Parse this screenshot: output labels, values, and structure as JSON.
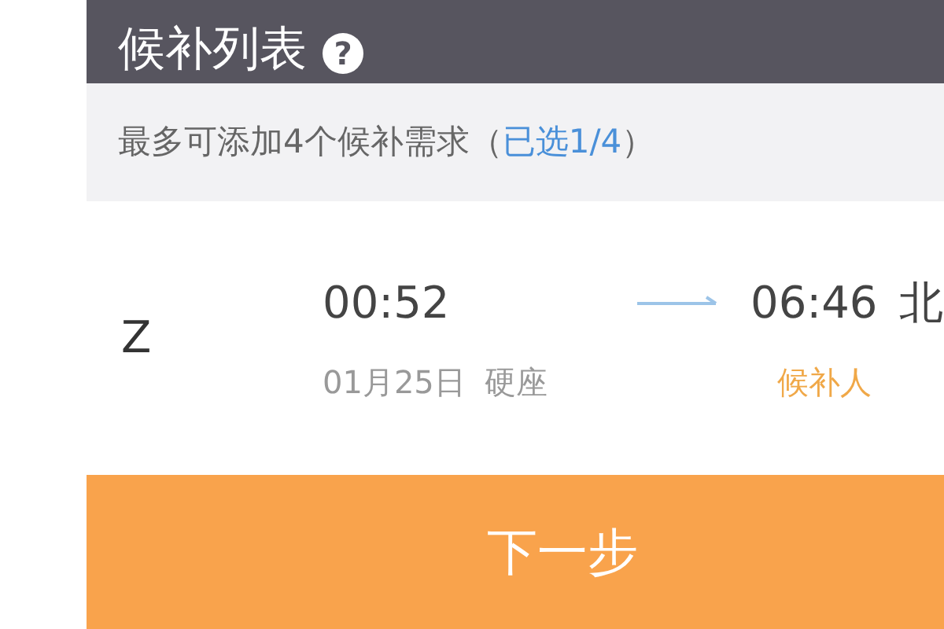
{
  "header": {
    "title": "候补列表",
    "help_icon": "?"
  },
  "notice": {
    "text": "最多可添加4个候补需求（",
    "highlight": "已选1/4",
    "suffix": "）"
  },
  "trips": [
    {
      "train": "Z",
      "depart_time": "00:52",
      "arrive_time": "06:46",
      "arrive_station": "北",
      "date": "01月25日",
      "seat": "硬座",
      "passenger_label": "候补人"
    }
  ],
  "next_button": {
    "label": "下一步"
  }
}
